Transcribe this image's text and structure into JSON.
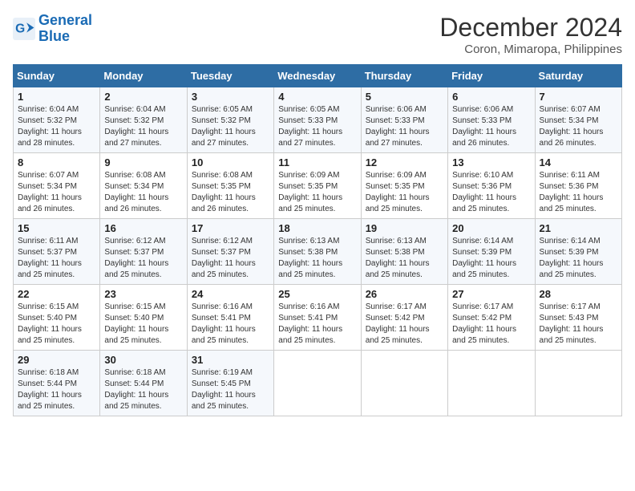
{
  "logo": {
    "line1": "General",
    "line2": "Blue"
  },
  "title": "December 2024",
  "subtitle": "Coron, Mimaropa, Philippines",
  "days_of_week": [
    "Sunday",
    "Monday",
    "Tuesday",
    "Wednesday",
    "Thursday",
    "Friday",
    "Saturday"
  ],
  "weeks": [
    [
      {
        "day": "1",
        "sunrise": "6:04 AM",
        "sunset": "5:32 PM",
        "daylight": "11 hours and 28 minutes."
      },
      {
        "day": "2",
        "sunrise": "6:04 AM",
        "sunset": "5:32 PM",
        "daylight": "11 hours and 27 minutes."
      },
      {
        "day": "3",
        "sunrise": "6:05 AM",
        "sunset": "5:32 PM",
        "daylight": "11 hours and 27 minutes."
      },
      {
        "day": "4",
        "sunrise": "6:05 AM",
        "sunset": "5:33 PM",
        "daylight": "11 hours and 27 minutes."
      },
      {
        "day": "5",
        "sunrise": "6:06 AM",
        "sunset": "5:33 PM",
        "daylight": "11 hours and 27 minutes."
      },
      {
        "day": "6",
        "sunrise": "6:06 AM",
        "sunset": "5:33 PM",
        "daylight": "11 hours and 26 minutes."
      },
      {
        "day": "7",
        "sunrise": "6:07 AM",
        "sunset": "5:34 PM",
        "daylight": "11 hours and 26 minutes."
      }
    ],
    [
      {
        "day": "8",
        "sunrise": "6:07 AM",
        "sunset": "5:34 PM",
        "daylight": "11 hours and 26 minutes."
      },
      {
        "day": "9",
        "sunrise": "6:08 AM",
        "sunset": "5:34 PM",
        "daylight": "11 hours and 26 minutes."
      },
      {
        "day": "10",
        "sunrise": "6:08 AM",
        "sunset": "5:35 PM",
        "daylight": "11 hours and 26 minutes."
      },
      {
        "day": "11",
        "sunrise": "6:09 AM",
        "sunset": "5:35 PM",
        "daylight": "11 hours and 25 minutes."
      },
      {
        "day": "12",
        "sunrise": "6:09 AM",
        "sunset": "5:35 PM",
        "daylight": "11 hours and 25 minutes."
      },
      {
        "day": "13",
        "sunrise": "6:10 AM",
        "sunset": "5:36 PM",
        "daylight": "11 hours and 25 minutes."
      },
      {
        "day": "14",
        "sunrise": "6:11 AM",
        "sunset": "5:36 PM",
        "daylight": "11 hours and 25 minutes."
      }
    ],
    [
      {
        "day": "15",
        "sunrise": "6:11 AM",
        "sunset": "5:37 PM",
        "daylight": "11 hours and 25 minutes."
      },
      {
        "day": "16",
        "sunrise": "6:12 AM",
        "sunset": "5:37 PM",
        "daylight": "11 hours and 25 minutes."
      },
      {
        "day": "17",
        "sunrise": "6:12 AM",
        "sunset": "5:37 PM",
        "daylight": "11 hours and 25 minutes."
      },
      {
        "day": "18",
        "sunrise": "6:13 AM",
        "sunset": "5:38 PM",
        "daylight": "11 hours and 25 minutes."
      },
      {
        "day": "19",
        "sunrise": "6:13 AM",
        "sunset": "5:38 PM",
        "daylight": "11 hours and 25 minutes."
      },
      {
        "day": "20",
        "sunrise": "6:14 AM",
        "sunset": "5:39 PM",
        "daylight": "11 hours and 25 minutes."
      },
      {
        "day": "21",
        "sunrise": "6:14 AM",
        "sunset": "5:39 PM",
        "daylight": "11 hours and 25 minutes."
      }
    ],
    [
      {
        "day": "22",
        "sunrise": "6:15 AM",
        "sunset": "5:40 PM",
        "daylight": "11 hours and 25 minutes."
      },
      {
        "day": "23",
        "sunrise": "6:15 AM",
        "sunset": "5:40 PM",
        "daylight": "11 hours and 25 minutes."
      },
      {
        "day": "24",
        "sunrise": "6:16 AM",
        "sunset": "5:41 PM",
        "daylight": "11 hours and 25 minutes."
      },
      {
        "day": "25",
        "sunrise": "6:16 AM",
        "sunset": "5:41 PM",
        "daylight": "11 hours and 25 minutes."
      },
      {
        "day": "26",
        "sunrise": "6:17 AM",
        "sunset": "5:42 PM",
        "daylight": "11 hours and 25 minutes."
      },
      {
        "day": "27",
        "sunrise": "6:17 AM",
        "sunset": "5:42 PM",
        "daylight": "11 hours and 25 minutes."
      },
      {
        "day": "28",
        "sunrise": "6:17 AM",
        "sunset": "5:43 PM",
        "daylight": "11 hours and 25 minutes."
      }
    ],
    [
      {
        "day": "29",
        "sunrise": "6:18 AM",
        "sunset": "5:44 PM",
        "daylight": "11 hours and 25 minutes."
      },
      {
        "day": "30",
        "sunrise": "6:18 AM",
        "sunset": "5:44 PM",
        "daylight": "11 hours and 25 minutes."
      },
      {
        "day": "31",
        "sunrise": "6:19 AM",
        "sunset": "5:45 PM",
        "daylight": "11 hours and 25 minutes."
      },
      null,
      null,
      null,
      null
    ]
  ]
}
